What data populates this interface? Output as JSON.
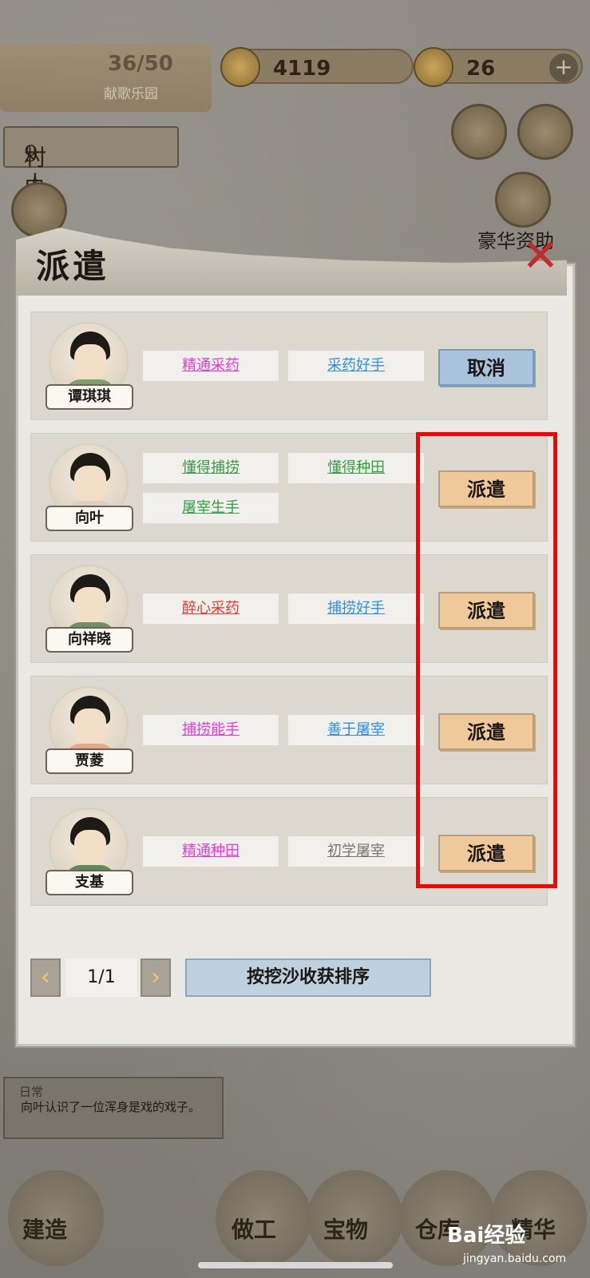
{
  "hud": {
    "level_progress": "36/50",
    "level_subtitle": "献歌乐园",
    "coins": "4119",
    "gold": "26",
    "plus_icon": "+"
  },
  "villager_tab": {
    "label": "村民",
    "count": "9人"
  },
  "deluxe_support_label": "豪华资助",
  "modal": {
    "title": "派遣",
    "close_icon": "✕",
    "rows": [
      {
        "name": "谭琪琪",
        "traits": [
          {
            "label": "精通采药",
            "color": "#e83ad6"
          },
          {
            "label": "采药好手",
            "color": "#2e8fe0"
          }
        ],
        "action": "取消",
        "action_type": "cancel"
      },
      {
        "name": "向叶",
        "traits": [
          {
            "label": "懂得捕捞",
            "color": "#33a043"
          },
          {
            "label": "懂得种田",
            "color": "#33a043"
          },
          {
            "label": "屠宰生手",
            "color": "#33a043"
          }
        ],
        "action": "派遣",
        "action_type": "dispatch"
      },
      {
        "name": "向祥晓",
        "traits": [
          {
            "label": "醉心采药",
            "color": "#e03b3b"
          },
          {
            "label": "捕捞好手",
            "color": "#2e8fe0"
          }
        ],
        "action": "派遣",
        "action_type": "dispatch"
      },
      {
        "name": "贾菱",
        "traits": [
          {
            "label": "捕捞能手",
            "color": "#e83ad6"
          },
          {
            "label": "善于屠宰",
            "color": "#2e8fe0"
          }
        ],
        "action": "派遣",
        "action_type": "dispatch"
      },
      {
        "name": "支基",
        "traits": [
          {
            "label": "精通种田",
            "color": "#e83ad6"
          },
          {
            "label": "初学屠宰",
            "color": "#7a7670"
          }
        ],
        "action": "派遣",
        "action_type": "dispatch"
      }
    ],
    "pager": {
      "prev_icon": "‹",
      "page": "1/1",
      "next_icon": "›"
    },
    "sort_button": "按挖沙收获排序"
  },
  "daily_log": {
    "title": "日常",
    "text": "向叶认识了一位浑身是戏的戏子。"
  },
  "bottom_nav": [
    "建造",
    "做工",
    "宝物",
    "仓库",
    "精华"
  ],
  "watermark": {
    "brand": "Bai经验",
    "url": "jingyan.baidu.com"
  },
  "colors": {
    "dispatch_button": "#f0c99b",
    "cancel_button": "#a9c3dc",
    "highlight": "#ff0000"
  }
}
